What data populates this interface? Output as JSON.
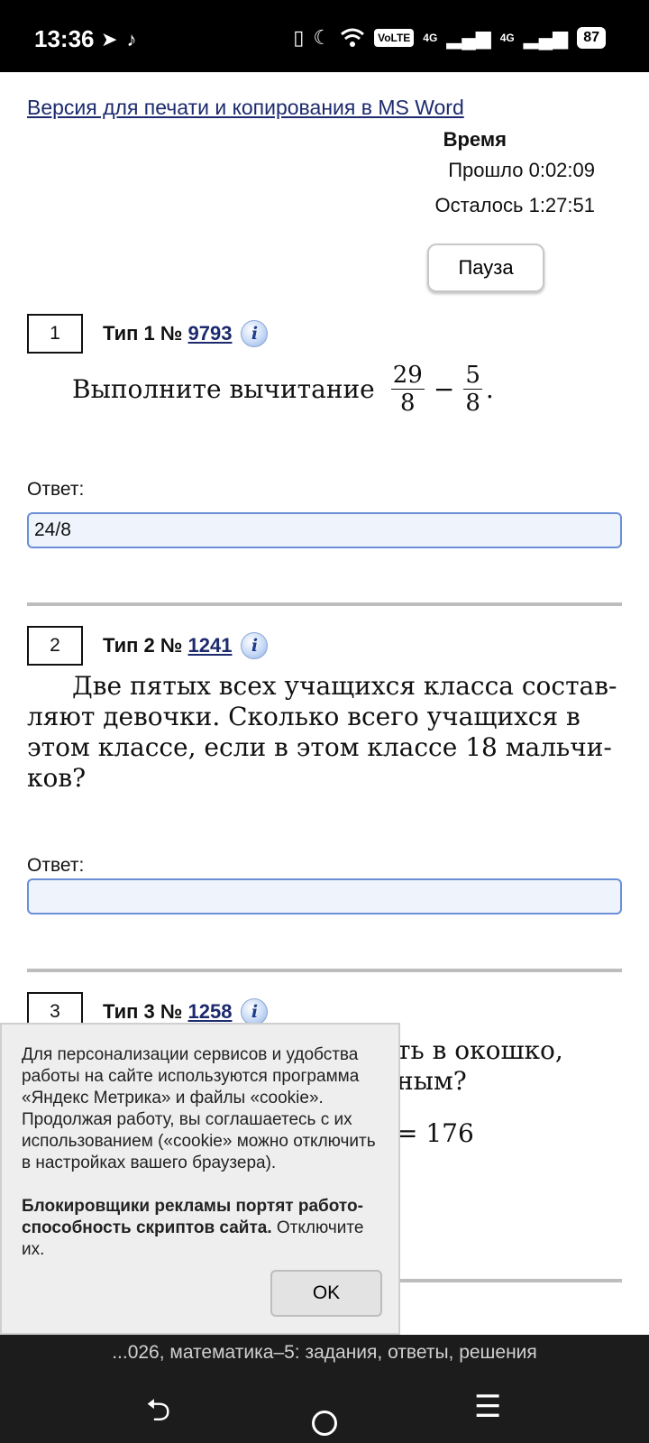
{
  "status": {
    "time": "13:36",
    "left_icons": [
      "telegram-icon",
      "tiktok-icon"
    ],
    "right_icons": [
      "vibrate-icon",
      "moon-icon",
      "wifi-icon",
      "volte-icon",
      "signal-4g-icon",
      "signal-4g-icon",
      "battery-icon"
    ],
    "volte": "VoLTE",
    "sim1": "4G",
    "sim2": "4G",
    "battery": "87"
  },
  "print_link": "Версия для печати и копирования в MS Word",
  "timer": {
    "title": "Время",
    "elapsed": "Прошло 0:02:09",
    "remaining": "Осталось 1:27:51",
    "pause": "Пауза"
  },
  "tasks": [
    {
      "number": "1",
      "type_prefix": "Тип 1 №",
      "id": "9793",
      "question": "Выполните вычитание",
      "fraction1": {
        "num": "29",
        "den": "8"
      },
      "op": "−",
      "fraction2": {
        "num": "5",
        "den": "8"
      },
      "end": ".",
      "answer_label": "Ответ:",
      "answer_value": "24/8"
    },
    {
      "number": "2",
      "type_prefix": "Тип 2 №",
      "id": "1241",
      "question": "Две пятых всех учащихся класса состав­ляют девочки. Сколько всего учащихся в этом классе, если в этом классе 18 мальчи­ков?",
      "answer_label": "Ответ:",
      "answer_value": ""
    },
    {
      "number": "3",
      "type_prefix": "Тип 3 №",
      "id": "1258",
      "visible_fragment_1": "ть в окошко,",
      "visible_fragment_2": "ным?",
      "visible_fragment_3": "= 176"
    }
  ],
  "cookie": {
    "text": "Для персонализации сервисов и удоб­ства работы на сайте используются программа «Яндекс Метрика» и файлы «cookie». Продолжая работу, вы соглашае­тесь с их использованием («cookie» мо­жно отключить в настройках вашего бра­узера).",
    "adblock_bold": "Блокировщики рекламы портят работо­способность скриптов сайта.",
    "adblock_rest": " Отключите их.",
    "ok": "OK"
  },
  "url_bar": "...026, математика–5: задания, ответы, решения",
  "nav": {
    "back": "⮌",
    "menu": "☰"
  }
}
